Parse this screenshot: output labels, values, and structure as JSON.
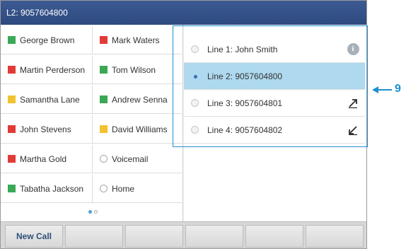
{
  "title_bar": {
    "text": "L2: 9057604800"
  },
  "favorites": [
    {
      "name": "George Brown",
      "color": "#3aa856",
      "type": "square"
    },
    {
      "name": "Mark Waters",
      "color": "#e23b37",
      "type": "square"
    },
    {
      "name": "Martin Perderson",
      "color": "#e23b37",
      "type": "square"
    },
    {
      "name": "Tom Wilson",
      "color": "#3aa856",
      "type": "square"
    },
    {
      "name": "Samantha Lane",
      "color": "#f2c230",
      "type": "square"
    },
    {
      "name": "Andrew Senna",
      "color": "#3aa856",
      "type": "square"
    },
    {
      "name": "John Stevens",
      "color": "#e23b37",
      "type": "square"
    },
    {
      "name": "David Williams",
      "color": "#f2c230",
      "type": "square"
    },
    {
      "name": "Martha Gold",
      "color": "#e23b37",
      "type": "square"
    },
    {
      "name": "Voicemail",
      "type": "circle"
    },
    {
      "name": "Tabatha Jackson",
      "color": "#3aa856",
      "type": "square"
    },
    {
      "name": "Home",
      "type": "circle"
    }
  ],
  "page_indicator": {
    "current": 1,
    "total": 2
  },
  "lines": [
    {
      "label": "Line 1: John Smith",
      "selected": false,
      "icon": "info-icon"
    },
    {
      "label": "Line 2: 9057604800",
      "selected": true,
      "icon": ""
    },
    {
      "label": "Line 3: 9057604801",
      "selected": false,
      "icon": "outgoing-call-arrow-icon"
    },
    {
      "label": "Line 4: 9057604802",
      "selected": false,
      "icon": "incoming-call-arrow-icon"
    }
  ],
  "softkeys": [
    "New Call",
    "",
    "",
    "",
    "",
    ""
  ],
  "callout": {
    "number": "9",
    "color": "#1f8fd0"
  },
  "colors": {
    "title_bar": "#34518a",
    "selected_line": "#aed9ef",
    "softkey_text": "#2f4f7a"
  }
}
